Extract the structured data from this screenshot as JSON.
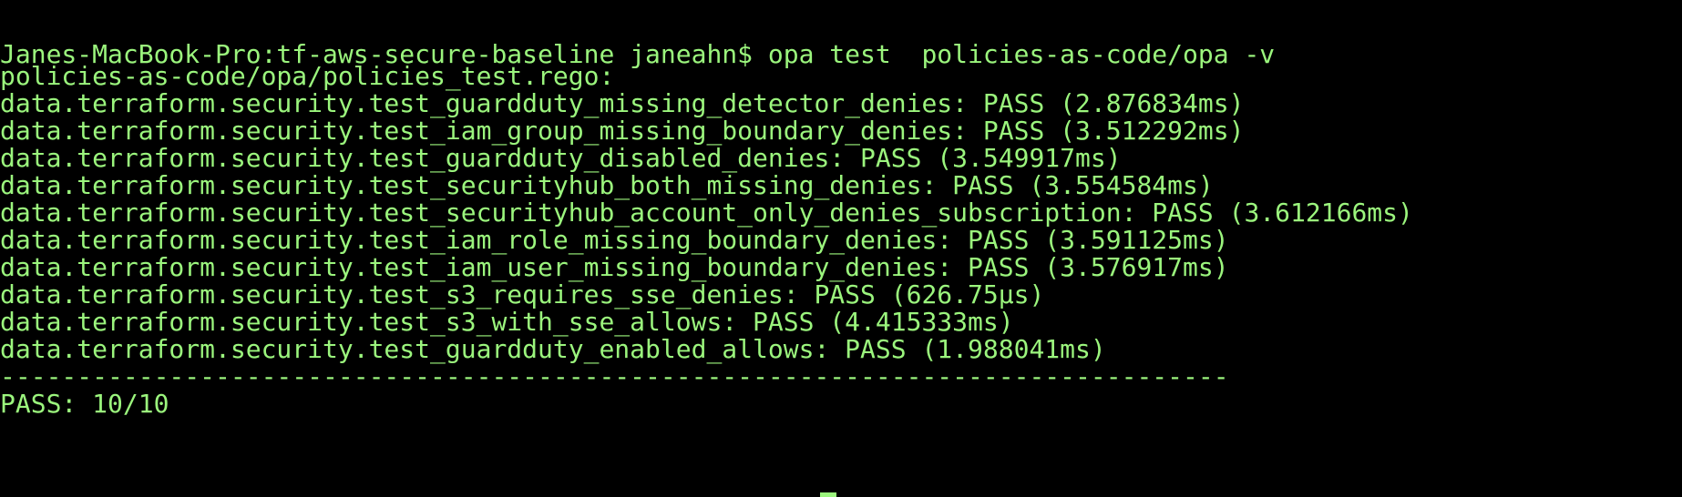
{
  "terminal": {
    "prompt_line": "Janes-MacBook-Pro:tf-aws-secure-baseline janeahn$ opa test  policies-as-code/opa -v",
    "file_header": "policies-as-code/opa/policies_test.rego:",
    "results": [
      "data.terraform.security.test_guardduty_missing_detector_denies: PASS (2.876834ms)",
      "data.terraform.security.test_iam_group_missing_boundary_denies: PASS (3.512292ms)",
      "data.terraform.security.test_guardduty_disabled_denies: PASS (3.549917ms)",
      "data.terraform.security.test_securityhub_both_missing_denies: PASS (3.554584ms)",
      "data.terraform.security.test_securityhub_account_only_denies_subscription: PASS (3.612166ms)",
      "data.terraform.security.test_iam_role_missing_boundary_denies: PASS (3.591125ms)",
      "data.terraform.security.test_iam_user_missing_boundary_denies: PASS (3.576917ms)",
      "data.terraform.security.test_s3_requires_sse_denies: PASS (626.75µs)",
      "data.terraform.security.test_s3_with_sse_allows: PASS (4.415333ms)",
      "data.terraform.security.test_guardduty_enabled_allows: PASS (1.988041ms)"
    ],
    "separator": "--------------------------------------------------------------------------------",
    "summary": "PASS: 10/10",
    "text_color": "#9BF57D",
    "background_color": "#000000"
  }
}
